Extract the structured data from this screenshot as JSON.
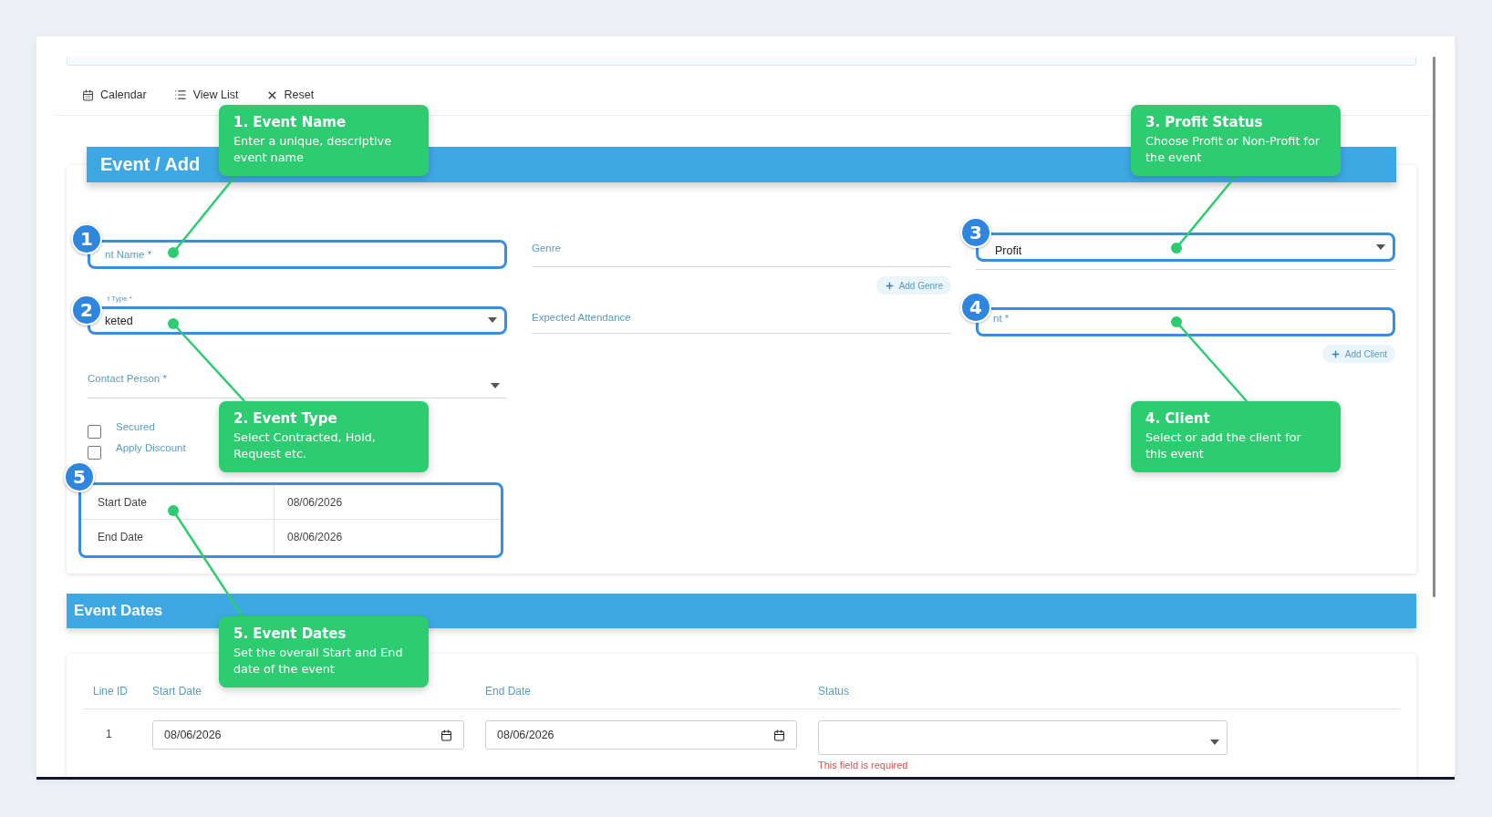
{
  "toolbar": [
    {
      "label": "Calendar"
    },
    {
      "label": "View List"
    },
    {
      "label": "Reset"
    }
  ],
  "event_form": {
    "title": "Event / Add",
    "event_name": {
      "label": "nt Name *"
    },
    "genre": {
      "label": "Genre"
    },
    "add_genre": "Add Genre",
    "profit_status": {
      "value": "Profit"
    },
    "event_type": {
      "label": "t Type *",
      "value": "keted"
    },
    "expected_attendance": {
      "label": "Expected Attendance"
    },
    "client": {
      "label": "nt *"
    },
    "add_client": "Add Client",
    "contact_person": {
      "label": "Contact Person *"
    },
    "checkboxes": [
      {
        "label": "Secured",
        "checked": false
      },
      {
        "label": "Apply Discount",
        "checked": false
      }
    ],
    "dates": [
      {
        "label": "Start Date",
        "value": "08/06/2026"
      },
      {
        "label": "End Date",
        "value": "08/06/2026"
      }
    ]
  },
  "event_dates": {
    "title": "Event Dates",
    "columns": [
      "Line ID",
      "Start Date",
      "End Date",
      "Status"
    ],
    "rows": [
      {
        "line_id": "1",
        "start_date": "08/06/2026",
        "end_date": "08/06/2026",
        "status_error": "This field is required"
      }
    ]
  },
  "callouts": [
    {
      "number": "1",
      "title": "1. Event Name",
      "text": "Enter a unique, descriptive event name"
    },
    {
      "number": "2",
      "title": "2. Event Type",
      "text": "Select Contracted, Hold, Request etc."
    },
    {
      "number": "3",
      "title": "3. Profit Status",
      "text": "Choose Profit or Non-Profit for the event"
    },
    {
      "number": "4",
      "title": "4. Client",
      "text": "Select or add the client for this event"
    },
    {
      "number": "5",
      "title": "5. Event Dates",
      "text": "Set the overall Start and End date of the event"
    }
  ]
}
